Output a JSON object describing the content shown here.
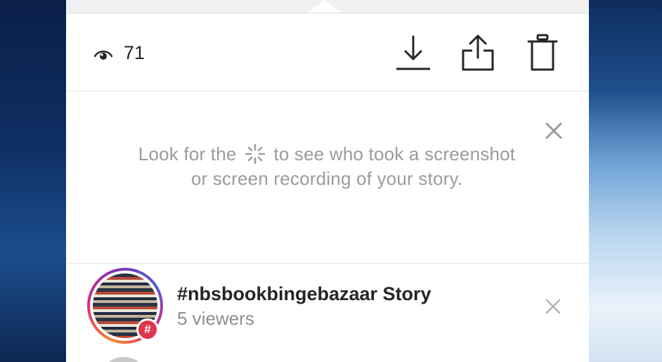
{
  "toolbar": {
    "view_count": "71",
    "icons": {
      "eye": "eye-icon",
      "download": "download-icon",
      "share": "share-icon",
      "delete": "trash-icon"
    }
  },
  "notice": {
    "text_before_icon": "Look for the",
    "text_after_icon": "to see who took a screenshot or screen recording of your story.",
    "inline_icon": "screenshot-spinner-icon",
    "close_icon": "close-icon"
  },
  "story": {
    "title": "#nbsbookbingebazaar Story",
    "viewers": "5 viewers",
    "badge": "#",
    "close_icon": "close-icon"
  },
  "colors": {
    "text_primary": "#262626",
    "text_muted": "#9b9b9b",
    "badge": "#e0354a",
    "divider": "#e3e3e3"
  }
}
